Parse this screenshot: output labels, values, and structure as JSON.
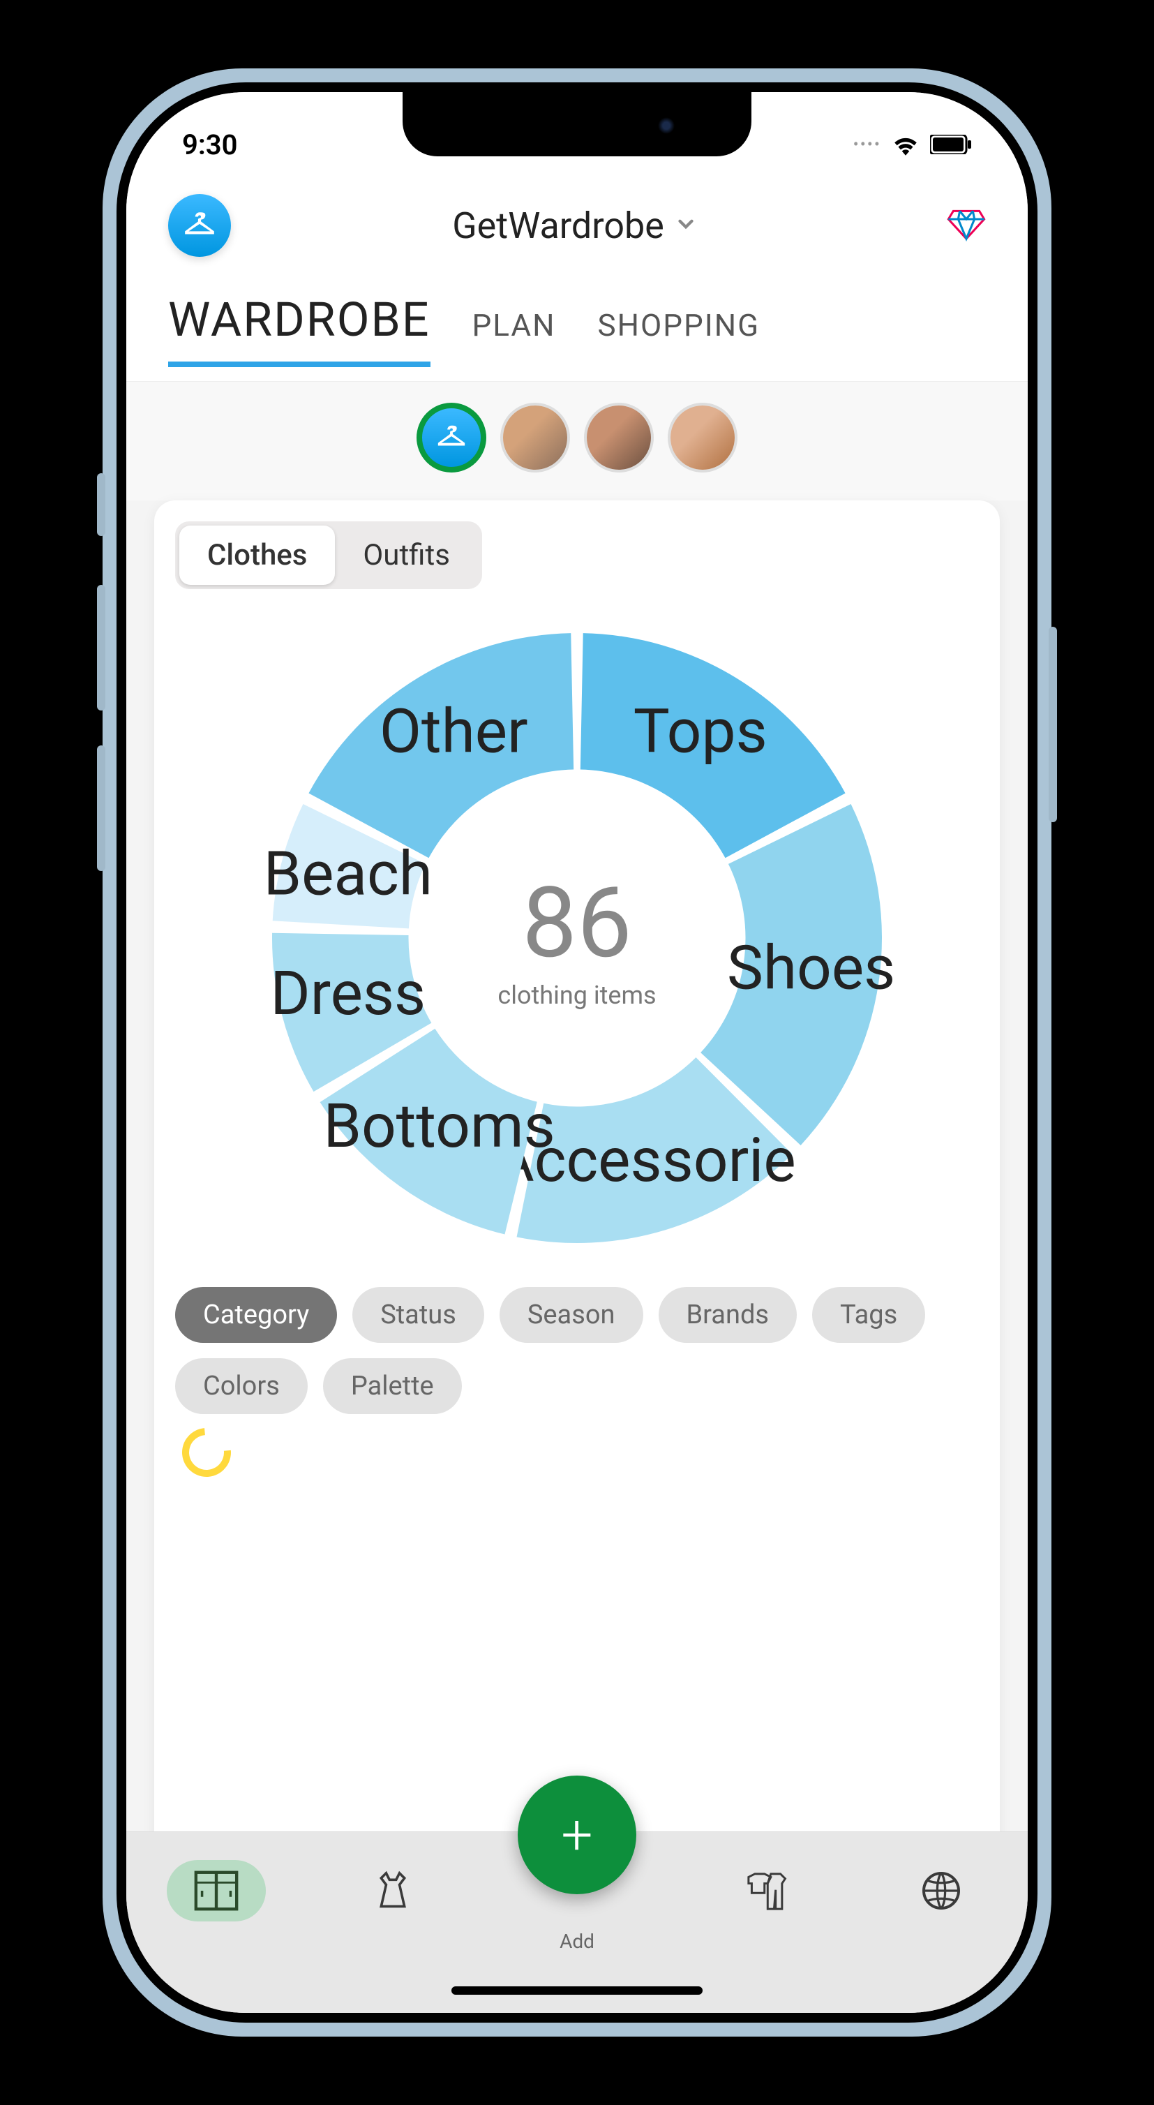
{
  "status": {
    "time": "9:30"
  },
  "header": {
    "app_name": "GetWardrobe"
  },
  "tabs": {
    "wardrobe": "WARDROBE",
    "plan": "PLAN",
    "shopping": "SHOPPING"
  },
  "segmented": {
    "clothes": "Clothes",
    "outfits": "Outfits"
  },
  "donut": {
    "total": "86",
    "sublabel": "clothing items"
  },
  "chart_data": {
    "type": "pie",
    "title": "clothing items",
    "total": 86,
    "categories": [
      "Tops",
      "Shoes",
      "Accessorie",
      "Bottoms",
      "Dress",
      "Beach",
      "Other"
    ],
    "values": [
      15,
      17,
      14,
      11,
      8,
      6,
      15
    ],
    "colors": [
      "#5dbfec",
      "#90d4ee",
      "#a9def2",
      "#a9def2",
      "#a9def2",
      "#d6eefb",
      "#72c7ed"
    ]
  },
  "filters": {
    "category": "Category",
    "status": "Status",
    "season": "Season",
    "brands": "Brands",
    "tags": "Tags",
    "colors": "Colors",
    "palette": "Palette"
  },
  "bottomnav": {
    "add": "Add"
  }
}
